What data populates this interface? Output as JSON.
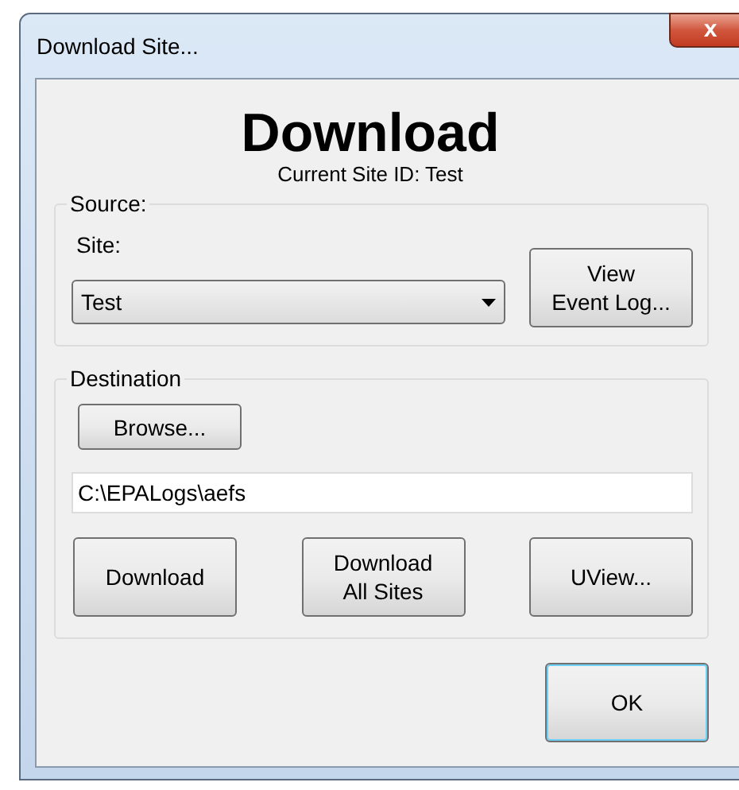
{
  "window": {
    "title": "Download Site...",
    "close": "x"
  },
  "heading": "Download",
  "subtitle": "Current Site ID: Test",
  "source": {
    "label": "Source:",
    "site_label": "Site:",
    "site_value": "Test",
    "view_button": "View\nEvent Log..."
  },
  "destination": {
    "label": "Destination",
    "browse_button": "Browse...",
    "path": "C:\\EPALogs\\aefs",
    "buttons": [
      {
        "label": "Download"
      },
      {
        "label": "Download\nAll Sites"
      },
      {
        "label": "UView..."
      }
    ]
  },
  "ok_button": {
    "label": "OK",
    "default": true
  }
}
